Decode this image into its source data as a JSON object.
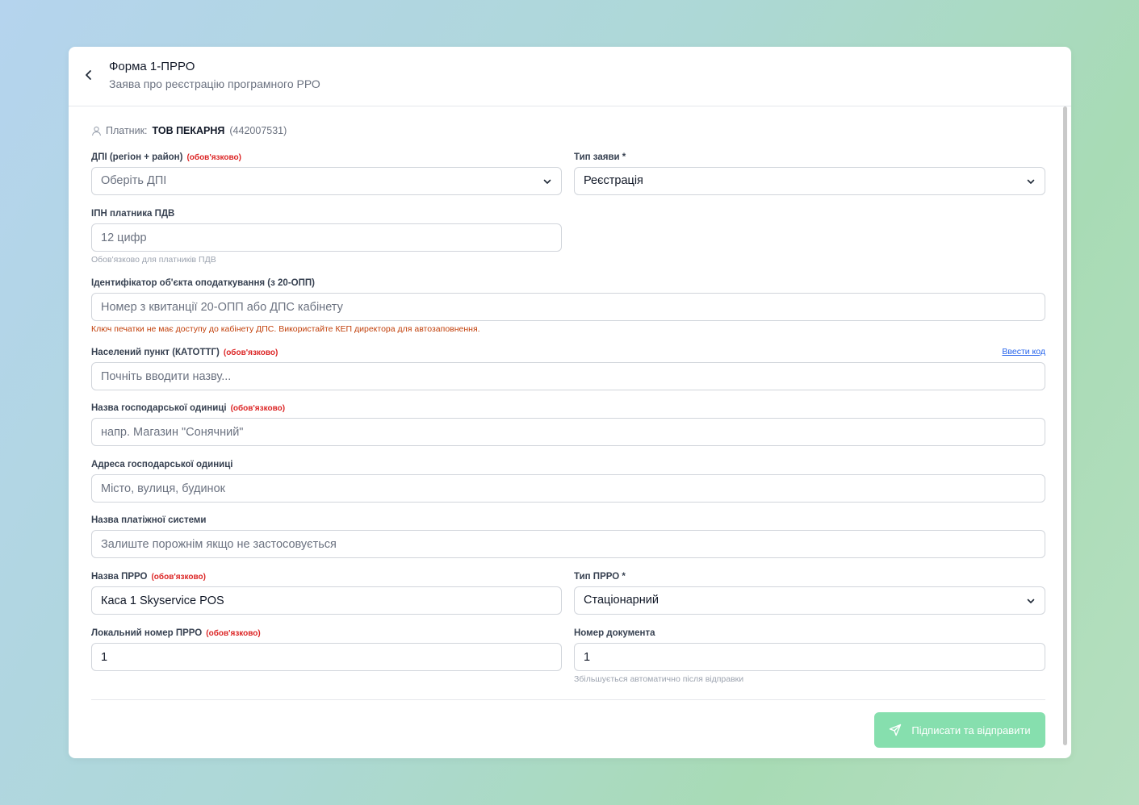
{
  "header": {
    "title": "Форма 1-ПРРО",
    "subtitle": "Заява про реєстрацію програмного РРО"
  },
  "payer": {
    "label": "Платник:",
    "name": "ТОВ ПЕКАРНЯ",
    "code": "(442007531)"
  },
  "form": {
    "dpi": {
      "label": "ДПІ (регіон + район)",
      "required": "(обов'язково)",
      "placeholder": "Оберіть ДПІ"
    },
    "request_type": {
      "label": "Тип заяви *",
      "value": "Реєстрація"
    },
    "vat_ipn": {
      "label": "ІПН платника ПДВ",
      "placeholder": "12 цифр",
      "hint": "Обов'язково для платників ПДВ"
    },
    "object_id": {
      "label": "Ідентифікатор об'єкта оподаткування (з 20-ОПП)",
      "placeholder": "Номер з квитанції 20-ОПП або ДПС кабінету",
      "warning": "Ключ печатки не має доступу до кабінету ДПС. Використайте КЕП директора для автозаповнення."
    },
    "settlement": {
      "label": "Населений пункт (КАТОТТГ)",
      "required": "(обов'язково)",
      "placeholder": "Почніть вводити назву...",
      "link": "Ввести код"
    },
    "unit_name": {
      "label": "Назва господарської одиниці",
      "required": "(обов'язково)",
      "placeholder": "напр. Магазин \"Сонячний\""
    },
    "unit_address": {
      "label": "Адреса господарської одиниці",
      "placeholder": "Місто, вулиця, будинок"
    },
    "payment_system": {
      "label": "Назва платіжної системи",
      "placeholder": "Залиште порожнім якщо не застосовується"
    },
    "prro_name": {
      "label": "Назва ПРРО",
      "required": "(обов'язково)",
      "value": "Каса 1 Skyservice POS"
    },
    "prro_type": {
      "label": "Тип ПРРО *",
      "value": "Стаціонарний"
    },
    "local_number": {
      "label": "Локальний номер ПРРО",
      "required": "(обов'язково)",
      "value": "1"
    },
    "doc_number": {
      "label": "Номер документа",
      "value": "1",
      "hint": "Збільшується автоматично після відправки"
    }
  },
  "submit": {
    "label": "Підписати та відправити"
  },
  "icons": {
    "back": "chevron-left-icon",
    "user": "user-icon",
    "dropdown": "chevron-down-icon",
    "send": "send-icon"
  },
  "colors": {
    "accent": "#86dfae",
    "required": "#dc2626",
    "warning": "#c2410c",
    "link": "#2563eb"
  }
}
